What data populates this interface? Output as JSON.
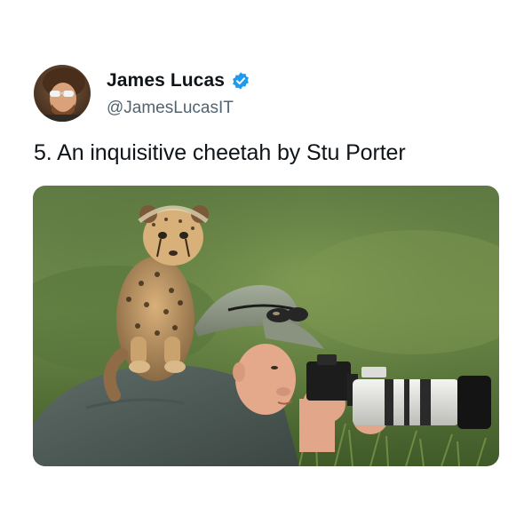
{
  "tweet": {
    "display_name": "James Lucas",
    "handle": "@JamesLucasIT",
    "verified": true,
    "text": "5. An inquisitive cheetah by Stu Porter",
    "media": {
      "alt": "cheetah cub perched on a photographer's shoulder"
    }
  },
  "colors": {
    "name": "#0f1419",
    "handle": "#536471",
    "verified_badge": "#1d9bf0"
  },
  "icons": {
    "verified": "verified-badge-icon"
  }
}
